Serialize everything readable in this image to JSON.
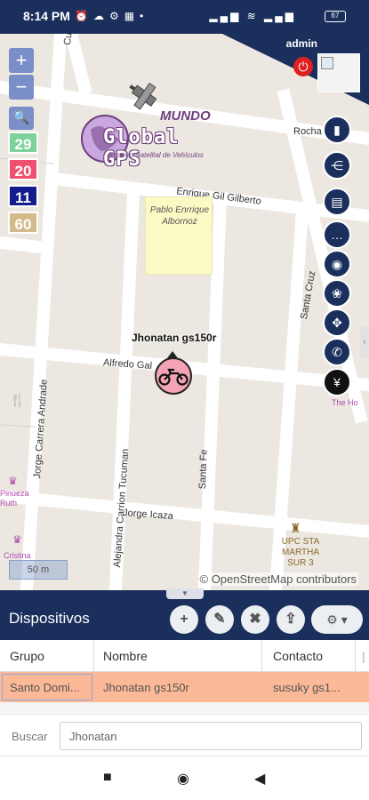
{
  "status_bar": {
    "time": "8:14 PM",
    "battery": "67"
  },
  "header": {
    "username": "admin"
  },
  "map": {
    "streets": {
      "rocha": "Rocha",
      "enrique": "Enrique Gil Gilberto",
      "santa_cruz": "Santa Cruz",
      "alfredo": "Alfredo Gal",
      "jorge_carrera": "Jorge Carrera Andrade",
      "carrion": "Alejandra Carrion Tucuman",
      "santa_fe": "Santa Fe",
      "jorge_icaza": "Jorge Icaza",
      "cuidad": "Cuidad"
    },
    "park_label": "Pablo Enrrique Albornoz",
    "pois": {
      "upc": "UPC STA MARTHA SUR 3",
      "pinueza": "Pinueza Ruth",
      "cristina": "Cristina",
      "the_ho": "The Ho"
    },
    "logo": {
      "mundo": "MUNDO",
      "global": "Global GPS",
      "subtitle": "Rastreo Satelital de Vehículos"
    },
    "status_counts": [
      {
        "value": "29",
        "color": "#7dd19a"
      },
      {
        "value": "20",
        "color": "#f0506e"
      },
      {
        "value": "11",
        "color": "#141c8c"
      },
      {
        "value": "60",
        "color": "#d4b98a"
      }
    ],
    "vehicle_label": "Jhonatan gs150r",
    "scale": "50 m",
    "attribution": "© OpenStreetMap contributors"
  },
  "devices": {
    "title": "Dispositivos",
    "columns": [
      "Grupo",
      "Nombre",
      "Contacto"
    ],
    "rows": [
      {
        "grupo": "Santo Domi...",
        "nombre": "Jhonatan gs150r",
        "contacto": "susuky gs1..."
      }
    ],
    "search_label": "Buscar",
    "search_value": "Jhonatan"
  }
}
